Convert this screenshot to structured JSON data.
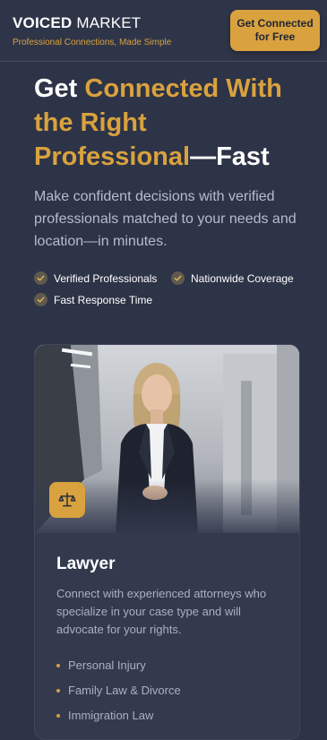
{
  "header": {
    "brand_bold": "VOICED",
    "brand_regular": "MARKET",
    "tagline": "Professional Connections, Made Simple",
    "cta_line1": "Get Connected",
    "cta_line2": "for Free"
  },
  "hero": {
    "title_line1_plain": "Get ",
    "title_line1_accent": "Connected With",
    "title_line2_accent": "the Right",
    "title_line3_accent": "Professional",
    "title_line3_plain": "—Fast",
    "subtitle": "Make confident decisions with verified professionals matched to your needs and location—in minutes.",
    "features": [
      {
        "label": "Verified Professionals",
        "icon": "check-icon"
      },
      {
        "label": "Nationwide Coverage",
        "icon": "check-icon"
      },
      {
        "label": "Fast Response Time",
        "icon": "check-icon"
      }
    ]
  },
  "card": {
    "icon": "scale-of-justice-icon",
    "title": "Lawyer",
    "description": "Connect with experienced attorneys who specialize in your case type and will advocate for your rights.",
    "items": [
      "Personal Injury",
      "Family Law & Divorce",
      "Immigration Law"
    ]
  },
  "colors": {
    "background": "#2e3447",
    "accent": "#d9a23f",
    "muted_text": "#b6bccb"
  }
}
